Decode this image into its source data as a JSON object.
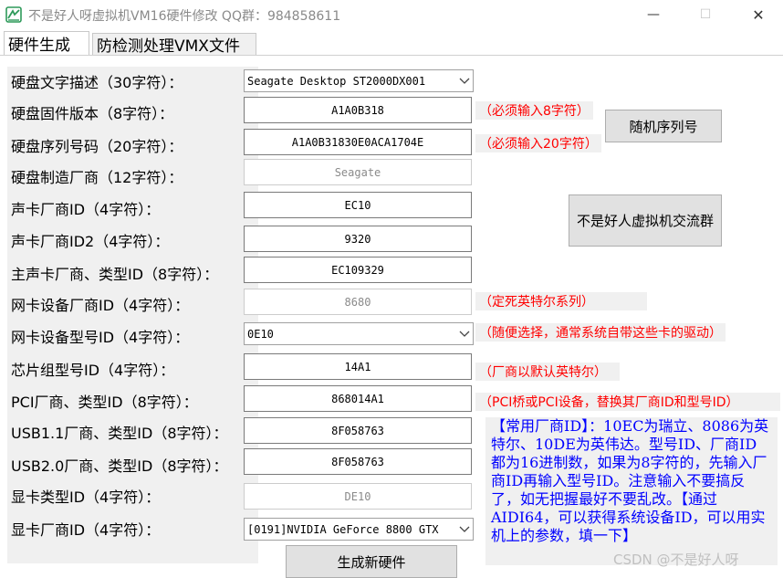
{
  "window": {
    "title": "不是好人呀虚拟机VM16硬件修改    QQ群：984858611",
    "minimize_glyph": "—",
    "maximize_glyph": "☐",
    "close_glyph": "✕"
  },
  "tabs": [
    {
      "label": "硬件生成",
      "active": true
    },
    {
      "label": "防检测处理VMX文件",
      "active": false
    }
  ],
  "form": {
    "rows": [
      {
        "label": "硬盘文字描述（30字符）：",
        "value": "Seagate Desktop ST2000DX001",
        "kind": "combo"
      },
      {
        "label": "硬盘固件版本（8字符）：",
        "value": "A1A0B318",
        "kind": "field"
      },
      {
        "label": "硬盘序列号码（20字符）：",
        "value": "A1A0B31830E0ACA1704E",
        "kind": "field"
      },
      {
        "label": "硬盘制造厂商（12字符）：",
        "value": "Seagate",
        "kind": "field-dim"
      },
      {
        "label": "声卡厂商ID（4字符）：",
        "value": "EC10",
        "kind": "field"
      },
      {
        "label": "声卡厂商ID2（4字符）：",
        "value": "9320",
        "kind": "field"
      },
      {
        "label": "主声卡厂商、类型ID（8字符）：",
        "value": "EC109329",
        "kind": "field"
      },
      {
        "label": "网卡设备厂商ID（4字符）：",
        "value": "8680",
        "kind": "field-dim"
      },
      {
        "label": "网卡设备型号ID（4字符）：",
        "value": "0E10",
        "kind": "combo"
      },
      {
        "label": "芯片组型号ID（4字符）：",
        "value": "14A1",
        "kind": "field"
      },
      {
        "label": "PCI厂商、类型ID（8字符）：",
        "value": "868014A1",
        "kind": "field"
      },
      {
        "label": "USB1.1厂商、类型ID（8字符）：",
        "value": "8F058763",
        "kind": "field"
      },
      {
        "label": "USB2.0厂商、类型ID（8字符）：",
        "value": "8F058763",
        "kind": "field"
      },
      {
        "label": "显卡类型ID（4字符）：",
        "value": "DE10",
        "kind": "field-dim"
      },
      {
        "label": "显卡厂商ID（4字符）：",
        "value": "[0191]NVIDIA GeForce 8800 GTX",
        "kind": "combo"
      }
    ]
  },
  "hints": {
    "fw": "（必须输入8字符）",
    "serial": "（必须输入20字符）",
    "nic_vendor": "（定死英特尔系列）",
    "nic_model": "（随便选择，通常系统自带这些卡的驱动）",
    "chipset": "（厂商以默认英特尔）",
    "pci": "（PCI桥或PCI设备，替换其厂商ID和型号ID）"
  },
  "buttons": {
    "random_serial": "随机序列号",
    "group": "不是好人虚拟机交流群",
    "generate": "生成新硬件"
  },
  "note": "【常用厂商ID】：10EC为瑞立、8086为英特尔、10DE为英伟达。型号ID、厂商ID 都为16进制数，如果为8字符的，先输入厂商ID再输入型号ID。注意输入不要搞反了，如无把握最好不要乱改。【通过AIDI64，可以获得系统设备ID，可以用实机上的参数，填一下】",
  "watermark": "CSDN @不是好人呀",
  "colors": {
    "hint_text": "#ff0000",
    "note_text": "#0000ff"
  }
}
